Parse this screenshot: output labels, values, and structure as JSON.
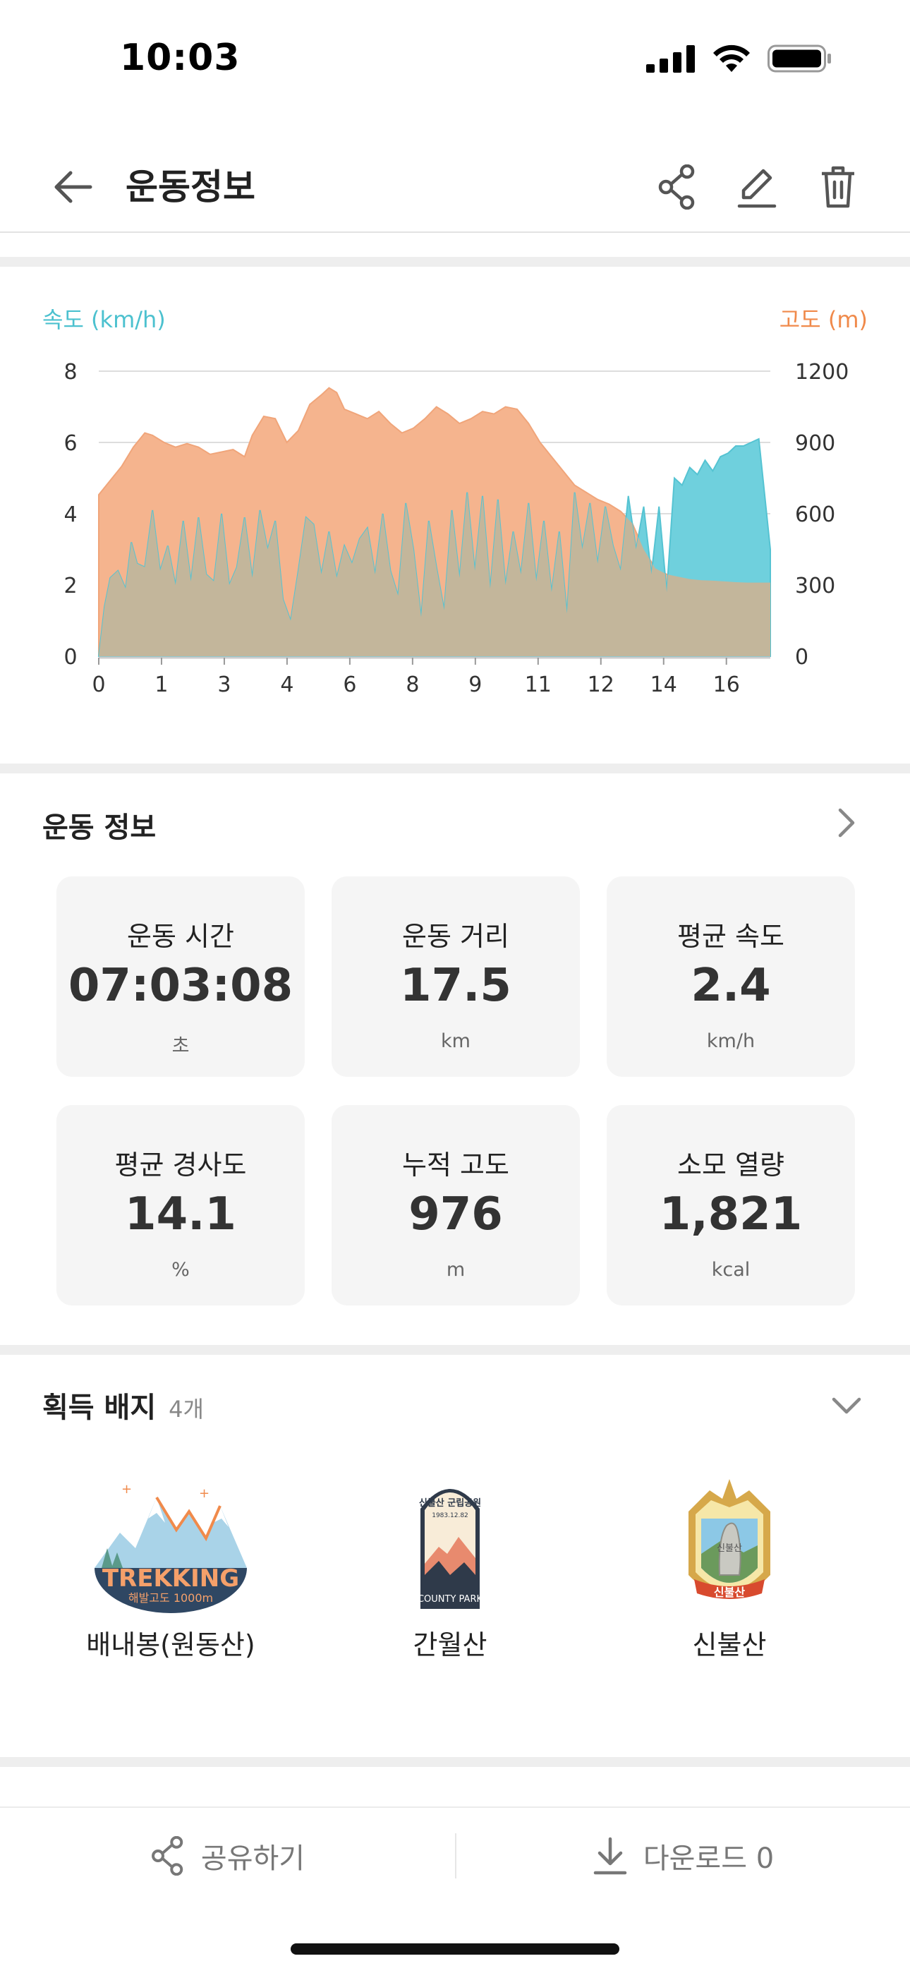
{
  "status_bar": {
    "time": "10:03"
  },
  "header": {
    "title": "운동정보",
    "icons": [
      "back-arrow-icon",
      "share-icon",
      "edit-icon",
      "trash-icon"
    ]
  },
  "chart": {
    "left_axis_title": "속도 (km/h)",
    "right_axis_title": "고도 (m)",
    "colors": {
      "speed": "#6fd0dd",
      "altitude": "#f5b48e",
      "overlap": "#c3b69b",
      "left_title": "#4cc1cf",
      "right_title": "#f08a4b"
    }
  },
  "chart_data": {
    "type": "area",
    "x_ticks": [
      "0",
      "1",
      "3",
      "4",
      "6",
      "8",
      "9",
      "11",
      "12",
      "14",
      "16"
    ],
    "y_left_ticks": [
      "8",
      "6",
      "4",
      "2",
      "0"
    ],
    "y_right_ticks": [
      "1200",
      "900",
      "600",
      "300",
      "0"
    ],
    "ylim_left": [
      0,
      8
    ],
    "ylim_right": [
      0,
      1200
    ],
    "xlim": [
      0,
      17.5
    ],
    "series": [
      {
        "name": "속도 (km/h)",
        "axis": "left",
        "x": [
          0,
          0.15,
          0.3,
          0.5,
          0.7,
          0.85,
          1.0,
          1.2,
          1.4,
          1.6,
          1.8,
          2.0,
          2.2,
          2.4,
          2.6,
          2.8,
          3.0,
          3.2,
          3.4,
          3.6,
          3.8,
          4.0,
          4.2,
          4.4,
          4.6,
          4.8,
          5.0,
          5.2,
          5.4,
          5.6,
          5.8,
          6.0,
          6.2,
          6.4,
          6.6,
          6.8,
          7.0,
          7.2,
          7.4,
          7.6,
          7.8,
          8.0,
          8.2,
          8.4,
          8.6,
          8.8,
          9.0,
          9.2,
          9.4,
          9.6,
          9.8,
          10.0,
          10.2,
          10.4,
          10.6,
          10.8,
          11.0,
          11.2,
          11.4,
          11.6,
          11.8,
          12.0,
          12.2,
          12.4,
          12.6,
          12.8,
          13.0,
          13.2,
          13.4,
          13.6,
          13.8,
          14.0,
          14.2,
          14.4,
          14.6,
          14.8,
          15.0,
          15.2,
          15.4,
          15.6,
          15.8,
          16.0,
          16.2,
          16.4,
          16.6,
          16.8,
          17.0,
          17.2,
          17.5
        ],
        "values": [
          0,
          1.4,
          2.2,
          2.4,
          1.9,
          3.2,
          2.6,
          2.5,
          4.1,
          2.4,
          3.1,
          2.0,
          3.8,
          2.1,
          3.9,
          2.3,
          2.1,
          4.0,
          2.0,
          2.5,
          3.9,
          2.2,
          4.1,
          3.0,
          3.8,
          1.6,
          1.0,
          2.4,
          3.9,
          3.7,
          2.3,
          3.5,
          2.2,
          3.1,
          2.6,
          3.3,
          3.6,
          2.3,
          4.0,
          2.4,
          1.7,
          4.3,
          3.0,
          1.1,
          3.8,
          2.5,
          1.3,
          4.1,
          2.2,
          4.6,
          2.4,
          4.5,
          1.9,
          4.4,
          2.0,
          3.5,
          2.3,
          4.3,
          2.1,
          3.8,
          1.8,
          3.5,
          1.2,
          4.6,
          3.0,
          4.3,
          2.6,
          4.2,
          3.1,
          2.4,
          4.5,
          3.0,
          4.2,
          2.3,
          4.2,
          1.8,
          5.0,
          4.8,
          5.3,
          5.1,
          5.5,
          5.2,
          5.6,
          5.7,
          5.9,
          5.9,
          6.0,
          6.1,
          3.0
        ],
        "color": "#6fd0dd"
      },
      {
        "name": "고도 (m)",
        "axis": "right",
        "x": [
          0,
          0.3,
          0.6,
          0.9,
          1.2,
          1.4,
          1.7,
          2.0,
          2.3,
          2.6,
          2.9,
          3.2,
          3.5,
          3.8,
          4.0,
          4.3,
          4.6,
          4.9,
          5.2,
          5.5,
          5.8,
          6.0,
          6.2,
          6.4,
          6.7,
          7.0,
          7.3,
          7.6,
          7.9,
          8.2,
          8.5,
          8.8,
          9.1,
          9.4,
          9.7,
          10.0,
          10.3,
          10.6,
          10.9,
          11.2,
          11.5,
          11.8,
          12.1,
          12.4,
          12.7,
          13.0,
          13.3,
          13.6,
          13.9,
          14.2,
          14.5,
          14.8,
          15.1,
          15.4,
          15.7,
          16.0,
          16.3,
          16.6,
          16.9,
          17.2,
          17.5
        ],
        "values": [
          680,
          740,
          800,
          880,
          940,
          930,
          900,
          880,
          895,
          880,
          850,
          860,
          870,
          840,
          930,
          1010,
          1000,
          900,
          950,
          1060,
          1100,
          1130,
          1110,
          1040,
          1020,
          1000,
          1030,
          980,
          940,
          960,
          1000,
          1050,
          1020,
          980,
          1000,
          1030,
          1020,
          1050,
          1040,
          980,
          900,
          840,
          780,
          720,
          690,
          660,
          640,
          610,
          560,
          450,
          370,
          345,
          335,
          325,
          320,
          318,
          315,
          312,
          310,
          310,
          310
        ],
        "color": "#f5b48e"
      }
    ]
  },
  "workout_info": {
    "title": "운동 정보",
    "stats": [
      {
        "label": "운동 시간",
        "value": "07:03:08",
        "unit": "초"
      },
      {
        "label": "운동 거리",
        "value": "17.5",
        "unit": "km"
      },
      {
        "label": "평균 속도",
        "value": "2.4",
        "unit": "km/h"
      },
      {
        "label": "평균 경사도",
        "value": "14.1",
        "unit": "%"
      },
      {
        "label": "누적 고도",
        "value": "976",
        "unit": "m"
      },
      {
        "label": "소모 열량",
        "value": "1,821",
        "unit": "kcal"
      }
    ]
  },
  "badges": {
    "title": "획득 배지",
    "count": "4개",
    "items": [
      {
        "name": "배내봉(원동산)",
        "emblem_text": "TREKKING",
        "emblem_sub": "해발고도 1000m"
      },
      {
        "name": "간월산",
        "emblem_text": "COUNTY PARK",
        "emblem_top": "신불산 군립공원",
        "emblem_date": "1983.12.82"
      },
      {
        "name": "신불산",
        "emblem_text": "신불산",
        "emblem_stone": "신불산"
      }
    ]
  },
  "bottom_bar": {
    "share_label": "공유하기",
    "download_label": "다운로드 0"
  }
}
